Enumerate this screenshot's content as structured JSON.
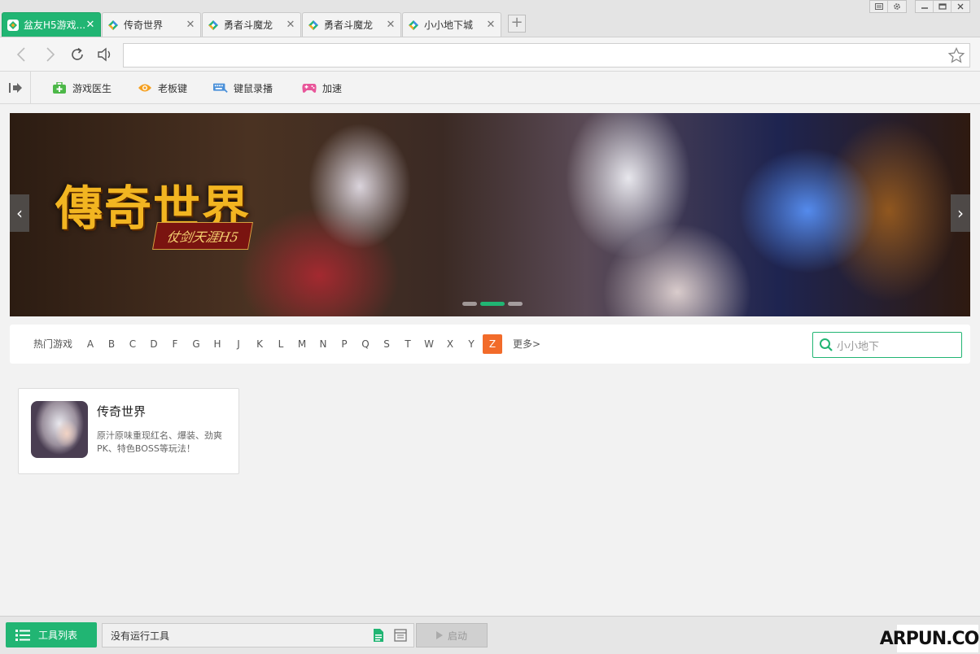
{
  "tabs": [
    {
      "label": "盆友H5游戏...",
      "active": true
    },
    {
      "label": "传奇世界",
      "active": false
    },
    {
      "label": "勇者斗魔龙",
      "active": false
    },
    {
      "label": "勇者斗魔龙",
      "active": false
    },
    {
      "label": "小小地下城",
      "active": false
    }
  ],
  "tab_close_glyph": "✕",
  "new_tab_glyph": "+",
  "address": {
    "value": ""
  },
  "toolbar": {
    "items": [
      {
        "label": "游戏医生",
        "icon": "medkit-icon"
      },
      {
        "label": "老板键",
        "icon": "eye-icon"
      },
      {
        "label": "键鼠录播",
        "icon": "keyboard-icon"
      },
      {
        "label": "加速",
        "icon": "gamepad-icon"
      }
    ]
  },
  "banner": {
    "title": "傳奇世界",
    "subtitle": "仗剑天涯H5",
    "prev_glyph": "‹",
    "next_glyph": "›"
  },
  "filter": {
    "hot_label": "热门游戏",
    "letters": [
      "A",
      "B",
      "C",
      "D",
      "F",
      "G",
      "H",
      "J",
      "K",
      "L",
      "M",
      "N",
      "P",
      "Q",
      "S",
      "T",
      "W",
      "X",
      "Y",
      "Z"
    ],
    "selected_letter": "Z",
    "more_label": "更多>",
    "search_value": "小小地下"
  },
  "results": [
    {
      "title": "传奇世界",
      "description": "原汁原味重现红名、爆装、劲爽PK、特色BOSS等玩法！"
    }
  ],
  "statusbar": {
    "tools_list_label": "工具列表",
    "running_text": "没有运行工具",
    "start_label": "启动",
    "watermark": "ARPUN.COM"
  },
  "colors": {
    "accent": "#21b573",
    "selected_letter": "#f26b2a"
  }
}
